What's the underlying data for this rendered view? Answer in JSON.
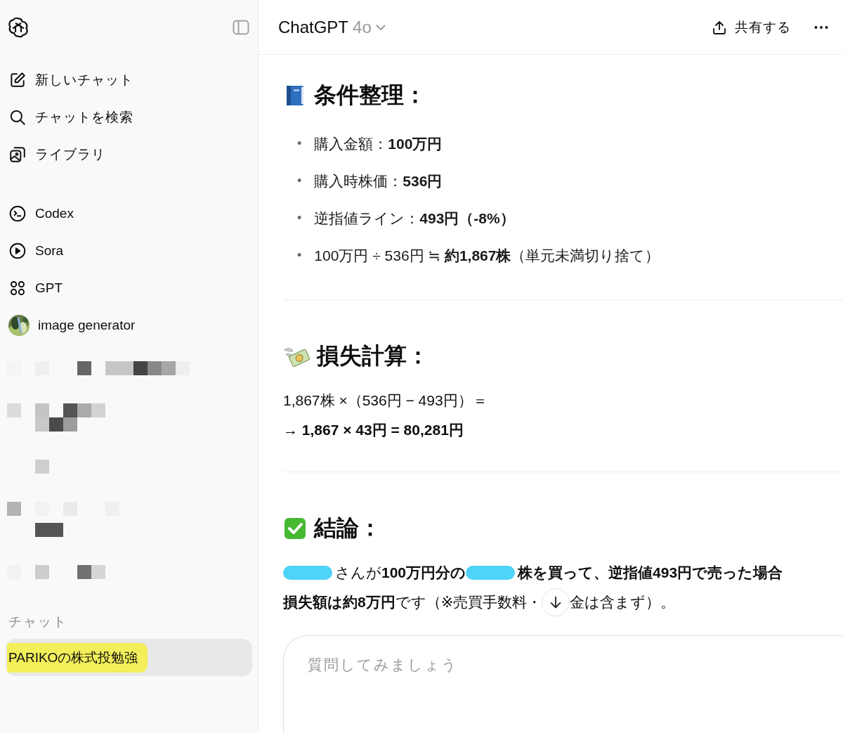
{
  "sidebar": {
    "nav": [
      {
        "label": "新しいチャット"
      },
      {
        "label": "チャットを検索"
      },
      {
        "label": "ライブラリ"
      }
    ],
    "tools": [
      {
        "label": "Codex"
      },
      {
        "label": "Sora"
      },
      {
        "label": "GPT"
      },
      {
        "label": "image generator"
      }
    ],
    "section_label": "チャット",
    "chats": [
      {
        "title": "PARIKOの株式投勉強",
        "selected": true,
        "highlighted": true
      }
    ]
  },
  "header": {
    "model": "ChatGPT",
    "version": "4o",
    "share": "共有する"
  },
  "sections": [
    {
      "heading": "条件整理：",
      "kind": "bullets",
      "items": [
        {
          "marker": "•",
          "text": "購入金額：**100万円**"
        },
        {
          "marker": "•",
          "text": "購入時株価：**536円**"
        },
        {
          "marker": "•",
          "text": "逆指値ライン：**493円（-8%）**"
        },
        {
          "marker": "•",
          "text": "100万円 ÷ 536円 ≒ **約1,867株**（単元未満切り捨て）"
        }
      ]
    },
    {
      "heading": "損失計算：",
      "kind": "lines",
      "lines": [
        {
          "text": "1,867株 ×（536円 − 493円）＝",
          "bold": false
        },
        {
          "text": "→ 1,867 × 43円 = 80,281円",
          "bold": true
        }
      ]
    },
    {
      "heading": "結論：",
      "kind": "paragraph",
      "lines": [
        [
          {
            "kind": "redaction"
          },
          {
            "kind": "text",
            "text": "さんが**100万円分の**"
          },
          {
            "kind": "redaction"
          },
          {
            "kind": "text",
            "text": "**株を買って、逆指値493円で売った場合**"
          }
        ],
        [
          {
            "kind": "text",
            "text": "**損失額は約8万円**です（※売買手数料・"
          },
          {
            "kind": "scroll_button"
          },
          {
            "kind": "text",
            "text": "金は含まず）。"
          }
        ]
      ]
    }
  ],
  "composer": {
    "placeholder": "質問してみましょう"
  }
}
